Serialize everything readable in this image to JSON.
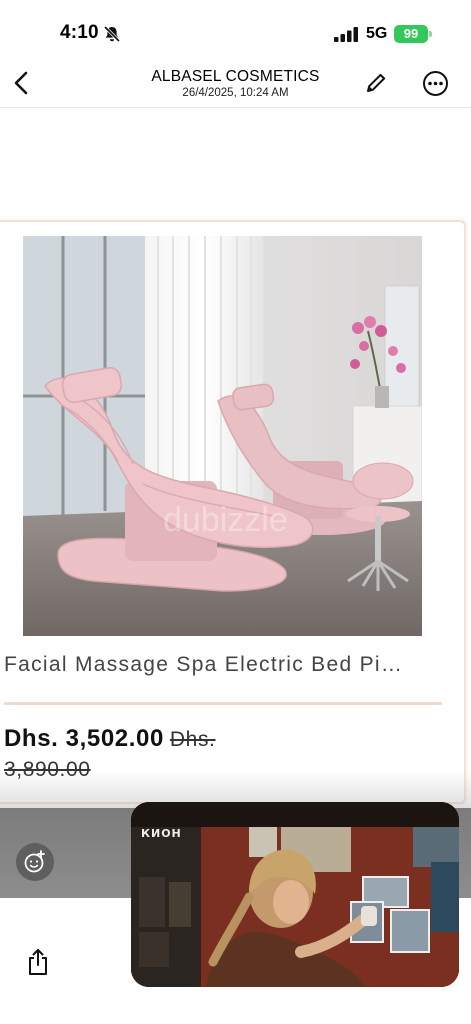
{
  "status": {
    "time": "4:10",
    "network": "5G",
    "battery": "99"
  },
  "header": {
    "title": "ALBASEL COSMETICS",
    "subtitle": "26/4/2025, 10:24 AM"
  },
  "product": {
    "title": "Facial Massage Spa Electric Bed Pi…",
    "price": "Dhs. 3,502.00",
    "old_price_part1": "Dhs.",
    "old_price_part2": "3,890.00",
    "watermark": "dubizzle"
  },
  "video": {
    "channel_logo": "КИОН"
  },
  "icons": [
    "bell-slash-icon",
    "signal-icon",
    "back-icon",
    "pencil-icon",
    "more-icon",
    "sticker-icon",
    "share-icon"
  ],
  "colors": {
    "battery": "#34c759",
    "card_border": "#f6e0d4",
    "chair_pink": "#e5b8bd"
  }
}
